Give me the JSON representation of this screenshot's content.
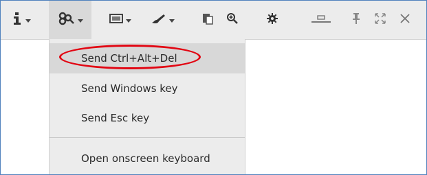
{
  "toolbar": {
    "icons": [
      {
        "name": "info-icon",
        "dropdown": true
      },
      {
        "name": "keyboard-shortcuts-icon",
        "dropdown": true,
        "active": true
      },
      {
        "name": "screenshot-icon",
        "dropdown": true
      },
      {
        "name": "brush-icon",
        "dropdown": true
      },
      {
        "name": "clipboard-icon",
        "dropdown": false
      },
      {
        "name": "zoom-in-icon",
        "dropdown": false
      },
      {
        "name": "gear-icon",
        "dropdown": false
      },
      {
        "name": "minimize-icon",
        "dropdown": false
      },
      {
        "name": "pin-icon",
        "dropdown": false
      },
      {
        "name": "fullscreen-icon",
        "dropdown": false
      },
      {
        "name": "close-icon",
        "dropdown": false
      }
    ]
  },
  "menu": {
    "items": [
      {
        "label": "Send Ctrl+Alt+Del",
        "highlighted": true
      },
      {
        "label": "Send Windows key"
      },
      {
        "label": "Send Esc key"
      },
      {
        "label": "Open onscreen keyboard"
      }
    ]
  },
  "colors": {
    "toolbar_bg": "#ececec",
    "menu_bg": "#ececec",
    "hover_bg": "#d8d8d8",
    "annotation_red": "#e20613",
    "frame_border": "#4f81bd"
  }
}
